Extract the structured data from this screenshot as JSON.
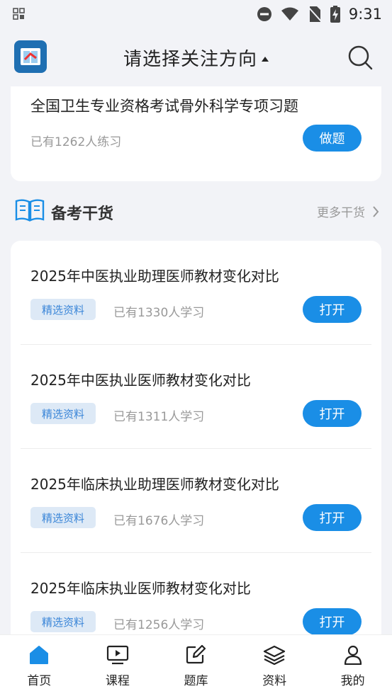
{
  "status": {
    "time": "9:31"
  },
  "header": {
    "title": "请选择关注方向"
  },
  "top_card": {
    "title": "全国卫生专业资格考试骨外科学专项习题",
    "count": "已有1262人练习",
    "button": "做题"
  },
  "section": {
    "title": "备考干货",
    "more": "更多干货"
  },
  "items": [
    {
      "title": "2025年中医执业助理医师教材变化对比",
      "tag": "精选资料",
      "count": "已有1330人学习",
      "button": "打开"
    },
    {
      "title": "2025年中医执业医师教材变化对比",
      "tag": "精选资料",
      "count": "已有1311人学习",
      "button": "打开"
    },
    {
      "title": "2025年临床执业助理医师教材变化对比",
      "tag": "精选资料",
      "count": "已有1676人学习",
      "button": "打开"
    },
    {
      "title": "2025年临床执业医师教材变化对比",
      "tag": "精选资料",
      "count": "已有1256人学习",
      "button": "打开"
    }
  ],
  "tabs": [
    {
      "label": "首页",
      "icon": "home-icon"
    },
    {
      "label": "课程",
      "icon": "video-icon"
    },
    {
      "label": "题库",
      "icon": "edit-icon"
    },
    {
      "label": "资料",
      "icon": "layers-icon"
    },
    {
      "label": "我的",
      "icon": "user-icon"
    }
  ],
  "colors": {
    "accent": "#1a8ee6",
    "tag_bg": "#dde9f6",
    "tag_text": "#3b86d8",
    "active_tab": "#1a8ee6"
  }
}
